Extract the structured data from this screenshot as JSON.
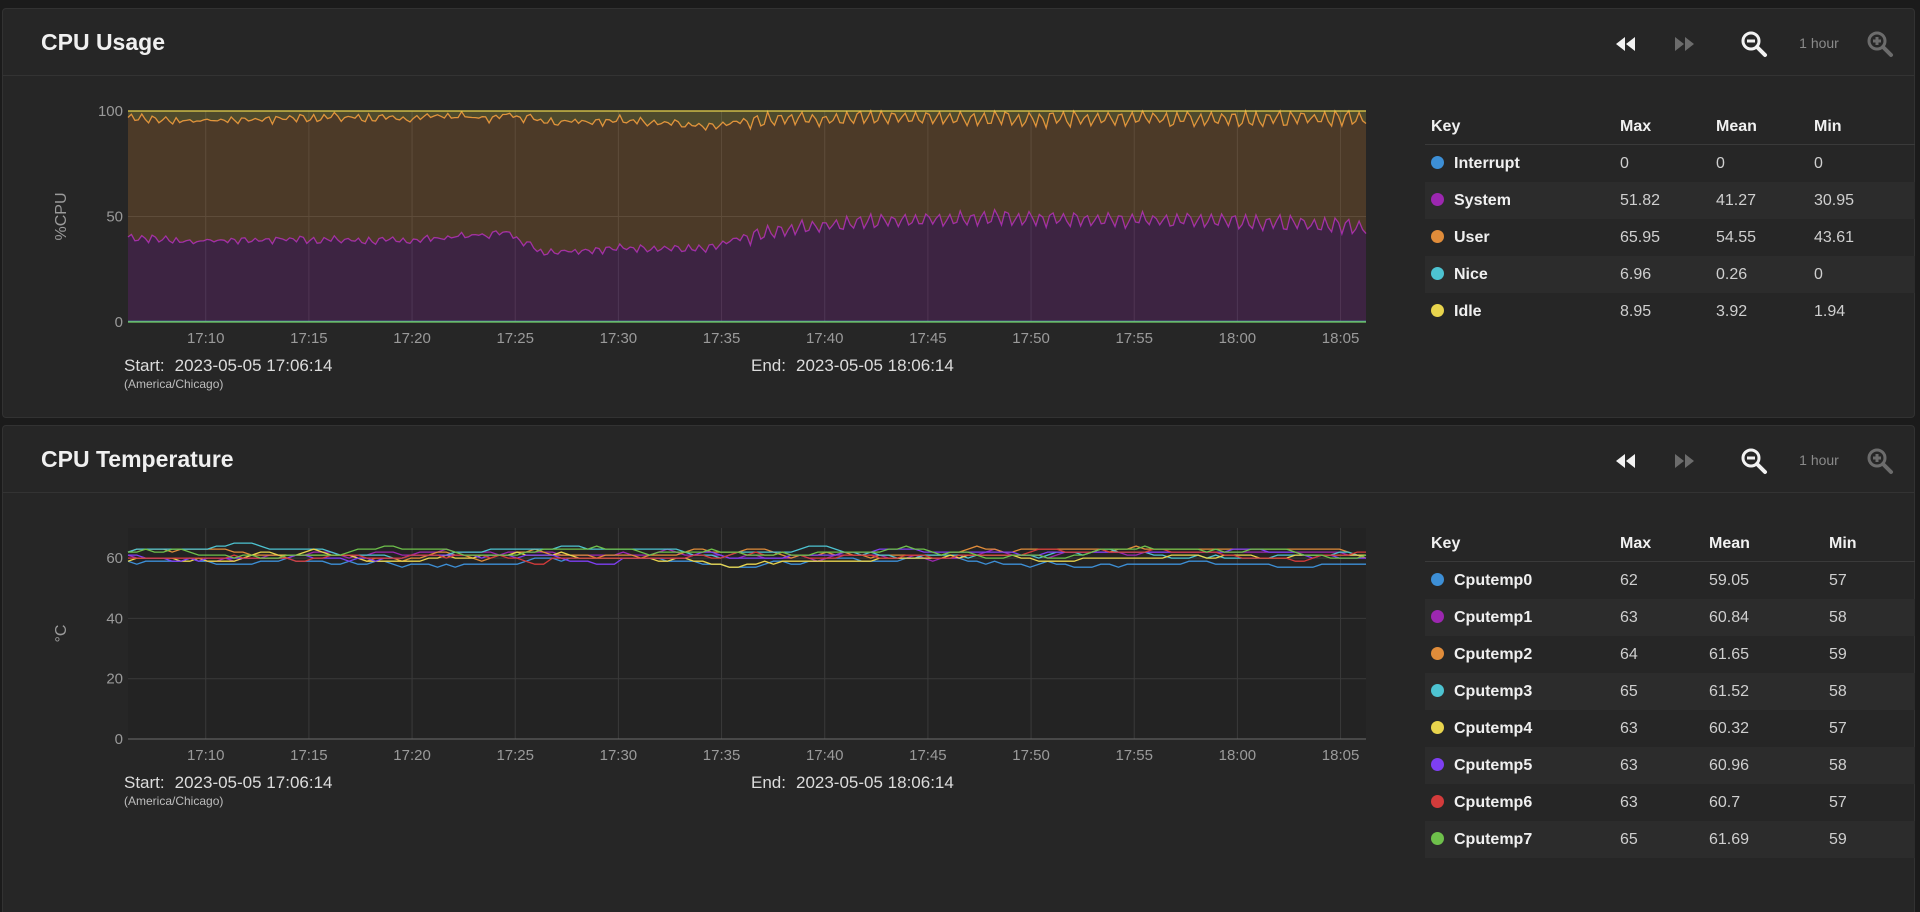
{
  "controls": {
    "range_label": "1 hour"
  },
  "panels": [
    {
      "id": "cpu",
      "title": "CPU Usage",
      "ylabel": "%CPU",
      "start_label": "Start:",
      "start": "2023-05-05 17:06:14",
      "timezone": "(America/Chicago)",
      "end_label": "End:",
      "end": "2023-05-05 18:06:14",
      "legend_headers": [
        "Key",
        "Max",
        "Mean",
        "Min"
      ],
      "legend": [
        {
          "name": "Interrupt",
          "max": "0",
          "mean": "0",
          "min": "0",
          "color": "#3d8fd6"
        },
        {
          "name": "System",
          "max": "51.82",
          "mean": "41.27",
          "min": "30.95",
          "color": "#9c27b0"
        },
        {
          "name": "User",
          "max": "65.95",
          "mean": "54.55",
          "min": "43.61",
          "color": "#e08c3a"
        },
        {
          "name": "Nice",
          "max": "6.96",
          "mean": "0.26",
          "min": "0",
          "color": "#4dc3d1"
        },
        {
          "name": "Idle",
          "max": "8.95",
          "mean": "3.92",
          "min": "1.94",
          "color": "#e8d44d"
        }
      ]
    },
    {
      "id": "temp",
      "title": "CPU Temperature",
      "ylabel": "°C",
      "start_label": "Start:",
      "start": "2023-05-05 17:06:14",
      "timezone": "(America/Chicago)",
      "end_label": "End:",
      "end": "2023-05-05 18:06:14",
      "legend_headers": [
        "Key",
        "Max",
        "Mean",
        "Min"
      ],
      "legend": [
        {
          "name": "Cputemp0",
          "max": "62",
          "mean": "59.05",
          "min": "57",
          "color": "#3d8fd6"
        },
        {
          "name": "Cputemp1",
          "max": "63",
          "mean": "60.84",
          "min": "58",
          "color": "#9c27b0"
        },
        {
          "name": "Cputemp2",
          "max": "64",
          "mean": "61.65",
          "min": "59",
          "color": "#e08c3a"
        },
        {
          "name": "Cputemp3",
          "max": "65",
          "mean": "61.52",
          "min": "58",
          "color": "#4dc3d1"
        },
        {
          "name": "Cputemp4",
          "max": "63",
          "mean": "60.32",
          "min": "57",
          "color": "#e8d44d"
        },
        {
          "name": "Cputemp5",
          "max": "63",
          "mean": "60.96",
          "min": "58",
          "color": "#7e3ff2"
        },
        {
          "name": "Cputemp6",
          "max": "63",
          "mean": "60.7",
          "min": "57",
          "color": "#d33b3b"
        },
        {
          "name": "Cputemp7",
          "max": "65",
          "mean": "61.69",
          "min": "59",
          "color": "#6ec04b"
        }
      ]
    }
  ],
  "chart_data": [
    {
      "type": "area",
      "title": "CPU Usage",
      "ylabel": "%CPU",
      "x_start": "17:06:14",
      "x_end": "18:06:14",
      "x_ticks": [
        "17:10",
        "17:15",
        "17:20",
        "17:25",
        "17:30",
        "17:35",
        "17:40",
        "17:45",
        "17:50",
        "17:55",
        "18:00",
        "18:05"
      ],
      "y_ticks": [
        0,
        50,
        100
      ],
      "ylim": [
        0,
        100
      ],
      "stacked": true,
      "grid": true,
      "series": [
        {
          "name": "Interrupt",
          "color": "#3d8fd6",
          "key_points": [
            [
              0,
              0
            ],
            [
              60,
              0
            ]
          ]
        },
        {
          "name": "Nice",
          "color": "#4dc3d1",
          "key_points": [
            [
              0,
              0.3
            ],
            [
              60,
              0.3
            ]
          ]
        },
        {
          "name": "System",
          "color": "#9c27b0",
          "key_points": [
            [
              0,
              40
            ],
            [
              3,
              38
            ],
            [
              8,
              39
            ],
            [
              13,
              38
            ],
            [
              18.5,
              42
            ],
            [
              20,
              33
            ],
            [
              25,
              35
            ],
            [
              28,
              34
            ],
            [
              30,
              40
            ],
            [
              33,
              45
            ],
            [
              37,
              48
            ],
            [
              42,
              49
            ],
            [
              47,
              48
            ],
            [
              53,
              48
            ],
            [
              57,
              46
            ],
            [
              60,
              45
            ]
          ]
        },
        {
          "name": "User",
          "color": "#e08c3a",
          "key_points": [
            [
              0,
              57
            ],
            [
              5,
              57
            ],
            [
              10,
              58
            ],
            [
              15,
              58
            ],
            [
              18,
              55
            ],
            [
              20,
              62
            ],
            [
              25,
              60
            ],
            [
              28,
              58
            ],
            [
              30,
              55
            ],
            [
              34,
              50
            ],
            [
              37,
              49
            ],
            [
              42,
              47
            ],
            [
              47,
              48
            ],
            [
              53,
              48
            ],
            [
              57,
              50
            ],
            [
              60,
              52
            ]
          ]
        },
        {
          "name": "Idle",
          "color": "#e8d44d",
          "key_points": [
            [
              0,
              2.5
            ],
            [
              20,
              3
            ],
            [
              30,
              4
            ],
            [
              40,
              4
            ],
            [
              50,
              4
            ],
            [
              60,
              3
            ]
          ]
        }
      ]
    },
    {
      "type": "line",
      "title": "CPU Temperature",
      "ylabel": "°C",
      "x_start": "17:06:14",
      "x_end": "18:06:14",
      "x_ticks": [
        "17:10",
        "17:15",
        "17:20",
        "17:25",
        "17:30",
        "17:35",
        "17:40",
        "17:45",
        "17:50",
        "17:55",
        "18:00",
        "18:05"
      ],
      "y_ticks": [
        0,
        20,
        40,
        60
      ],
      "ylim": [
        0,
        70
      ],
      "grid": true,
      "series": [
        {
          "name": "Cputemp0",
          "color": "#3d8fd6",
          "mean": 59.05,
          "min": 57,
          "max": 62
        },
        {
          "name": "Cputemp1",
          "color": "#9c27b0",
          "mean": 60.84,
          "min": 58,
          "max": 63
        },
        {
          "name": "Cputemp2",
          "color": "#e08c3a",
          "mean": 61.65,
          "min": 59,
          "max": 64
        },
        {
          "name": "Cputemp3",
          "color": "#4dc3d1",
          "mean": 61.52,
          "min": 58,
          "max": 65
        },
        {
          "name": "Cputemp4",
          "color": "#e8d44d",
          "mean": 60.32,
          "min": 57,
          "max": 63
        },
        {
          "name": "Cputemp5",
          "color": "#7e3ff2",
          "mean": 60.96,
          "min": 58,
          "max": 63
        },
        {
          "name": "Cputemp6",
          "color": "#d33b3b",
          "mean": 60.7,
          "min": 57,
          "max": 63
        },
        {
          "name": "Cputemp7",
          "color": "#6ec04b",
          "mean": 61.69,
          "min": 59,
          "max": 65
        }
      ]
    }
  ]
}
